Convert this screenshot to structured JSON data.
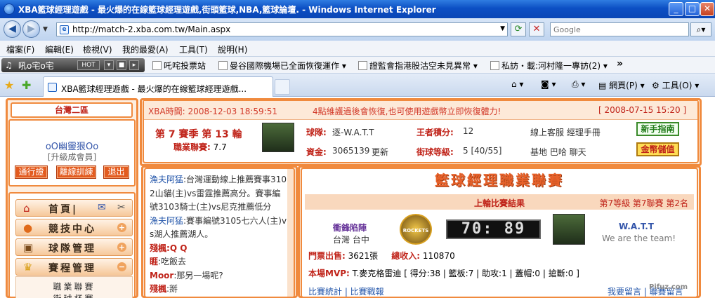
{
  "window": {
    "title": "XBA籃球經理遊戲 - 最火爆的在線籃球經理遊戲,街頭籃球,NBA,籃球論壇. - Windows Internet Explorer"
  },
  "address": {
    "url": "http://match-2.xba.com.tw/Main.aspx",
    "search_placeholder": "Google"
  },
  "menu": {
    "items": [
      "檔案(F)",
      "編輯(E)",
      "檢視(V)",
      "我的最愛(A)",
      "工具(T)",
      "說明(H)"
    ]
  },
  "links": {
    "radio_label": "吼o宅o宅",
    "radio_hot": "HOT",
    "items": [
      "吒咤投票站",
      "曼谷國際機場已全面恢復運作",
      "證監會指港股沽空未見異常",
      "私訪・載:河村隆一專訪(2)"
    ],
    "more": "»"
  },
  "tabs": {
    "active_label": "XBA籃球經理遊戲 - 最火爆的在線籃球經理遊戲...",
    "home": "",
    "page_menu": "網頁(P)",
    "tools_menu": "工具(O)"
  },
  "sidebar": {
    "region": "台灣二區",
    "username": "oO幽靈狠Oo",
    "member_link": "[升級成會員]",
    "buttons": [
      "通行證",
      "離線訓練",
      "退出"
    ],
    "nav": [
      {
        "label": "首頁|",
        "icon": "home-icon"
      },
      {
        "label": "競技中心",
        "icon": "basketball-icon"
      },
      {
        "label": "球隊管理",
        "icon": "team-icon"
      },
      {
        "label": "賽程管理",
        "icon": "trophy-icon"
      }
    ],
    "subnav": [
      "職業聯賽",
      "街球杯賽"
    ]
  },
  "info": {
    "time_label": "XBA時間:",
    "time_value": "2008-12-03 18:59:51",
    "announcement": "4點維護過後會恢復,也可使用遊戲幣立即恢復體力!",
    "announcement_date": "[ 2008-07-15 15:20 ]",
    "season_text": "第 7 賽季 第 13 輪",
    "league_label": "職業聯賽:",
    "league_value": "7.7",
    "team_label": "球隊:",
    "team_value": "逐-W.A.T.T",
    "king_label": "王者積分:",
    "king_value": "12",
    "funds_label": "資金:",
    "funds_value": "3065139",
    "funds_update": "更新",
    "level_label": "街球等級:",
    "level_value": "5 [40/55]",
    "right_links_1": "線上客服  經理手冊",
    "right_links_2": "基地  巴哈  聊天",
    "newbie_btn": "新手指南",
    "coin_btn": "金幣儲值"
  },
  "chat": {
    "lines": [
      {
        "name": "漁夫阿猛",
        "text": ":台灣運動線上推薦賽事3102山貓(主)vs雷霆推薦高分。賽事編號3103騎士(主)vs尼克推薦低分"
      },
      {
        "name": "漁夫阿猛",
        "text": ":賽事編號3105七六人(主)vs湖人推薦湖人。"
      },
      {
        "name": "殘楓",
        "text": ":Q Q",
        "red": true
      },
      {
        "name": "睚",
        "text": ":吃飯去",
        "red": true
      },
      {
        "name": "Moor",
        "text": ":那另一場呢?",
        "red": true
      },
      {
        "name": "殘楓",
        "text": ":掰",
        "red": true
      }
    ]
  },
  "match": {
    "banner": "籃球經理職業聯賽",
    "result_title": "上輪比賽結果",
    "result_meta": "第7等級  第7聯賽  第2名",
    "home_team": "衝鋒陷陣",
    "home_city": "台灣  台中",
    "home_logo_text": "ROCKETS",
    "score": "70: 89",
    "away_team": "W.A.T.T",
    "away_slogan": "We are the team!",
    "tickets_label": "門票出售:",
    "tickets_value": "3621張",
    "income_label": "總收入:",
    "income_value": "110870",
    "mvp_label": "本場MVP:",
    "mvp_value": "T.麥克格雷迪 [ 得分:38 | 籃板:7 | 助攻:1 | 蓋帽:0 | 搶斷:0 ]",
    "links_left": "比賽統計 | 比賽戰報",
    "links_right": "我要留言 | 聯賽留言"
  },
  "watermark": "Pifuz.com"
}
